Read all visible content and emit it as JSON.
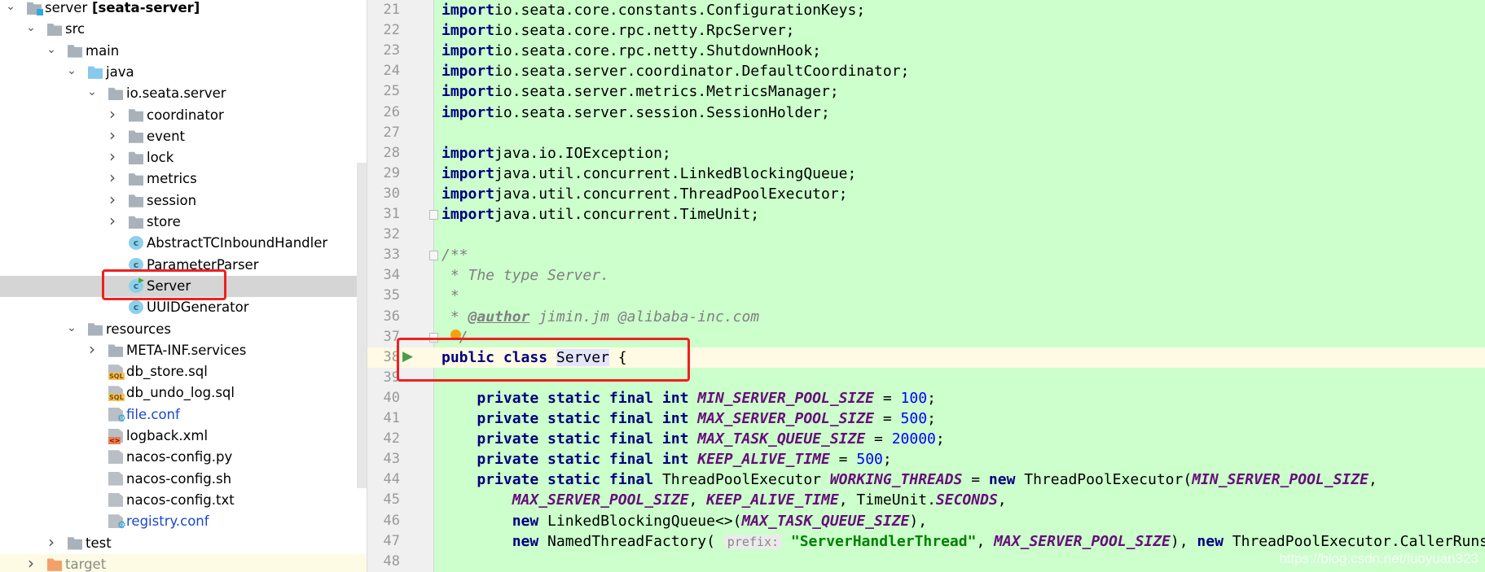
{
  "project_tree": [
    {
      "label": "server",
      "suffix": " [seata-server]",
      "level": 0,
      "chevron": "down",
      "icon": "module-folder-icon"
    },
    {
      "label": "src",
      "level": 1,
      "chevron": "down",
      "icon": "folder-icon"
    },
    {
      "label": "main",
      "level": 2,
      "chevron": "down",
      "icon": "folder-icon"
    },
    {
      "label": "java",
      "level": 3,
      "chevron": "down",
      "icon": "source-folder-icon"
    },
    {
      "label": "io.seata.server",
      "level": 4,
      "chevron": "down",
      "icon": "package-icon"
    },
    {
      "label": "coordinator",
      "level": 5,
      "chevron": "right",
      "icon": "package-icon"
    },
    {
      "label": "event",
      "level": 5,
      "chevron": "right",
      "icon": "package-icon"
    },
    {
      "label": "lock",
      "level": 5,
      "chevron": "right",
      "icon": "package-icon"
    },
    {
      "label": "metrics",
      "level": 5,
      "chevron": "right",
      "icon": "package-icon"
    },
    {
      "label": "session",
      "level": 5,
      "chevron": "right",
      "icon": "package-icon"
    },
    {
      "label": "store",
      "level": 5,
      "chevron": "right",
      "icon": "package-icon"
    },
    {
      "label": "AbstractTCInboundHandler",
      "level": 5,
      "chevron": "",
      "icon": "abstract-class-icon"
    },
    {
      "label": "ParameterParser",
      "level": 5,
      "chevron": "",
      "icon": "class-icon"
    },
    {
      "label": "Server",
      "level": 5,
      "chevron": "",
      "icon": "runnable-class-icon",
      "selected": true
    },
    {
      "label": "UUIDGenerator",
      "level": 5,
      "chevron": "",
      "icon": "class-icon"
    },
    {
      "label": "resources",
      "level": 3,
      "chevron": "down",
      "icon": "resources-folder-icon"
    },
    {
      "label": "META-INF.services",
      "level": 4,
      "chevron": "right",
      "icon": "package-icon"
    },
    {
      "label": "db_store.sql",
      "level": 4,
      "chevron": "",
      "icon": "sql-file-icon"
    },
    {
      "label": "db_undo_log.sql",
      "level": 4,
      "chevron": "",
      "icon": "sql-file-icon"
    },
    {
      "label": "file.conf",
      "level": 4,
      "chevron": "",
      "icon": "config-file-icon",
      "color": "#1a47c8"
    },
    {
      "label": "logback.xml",
      "level": 4,
      "chevron": "",
      "icon": "xml-file-icon"
    },
    {
      "label": "nacos-config.py",
      "level": 4,
      "chevron": "",
      "icon": "text-file-icon"
    },
    {
      "label": "nacos-config.sh",
      "level": 4,
      "chevron": "",
      "icon": "text-file-icon"
    },
    {
      "label": "nacos-config.txt",
      "level": 4,
      "chevron": "",
      "icon": "text-file-icon"
    },
    {
      "label": "registry.conf",
      "level": 4,
      "chevron": "",
      "icon": "config-file-icon",
      "color": "#1a47c8"
    },
    {
      "label": "test",
      "level": 2,
      "chevron": "right",
      "icon": "folder-icon"
    },
    {
      "label": "target",
      "level": 1,
      "chevron": "right",
      "icon": "excluded-folder-icon",
      "color": "#8a8a8a",
      "excluded": true
    }
  ],
  "editor": {
    "caret_line": 38,
    "lines": [
      {
        "n": 21,
        "t": [
          [
            "kw",
            "import"
          ],
          [
            "",
            "io.seata.core.constants.ConfigurationKeys;"
          ]
        ]
      },
      {
        "n": 22,
        "t": [
          [
            "kw",
            "import"
          ],
          [
            "",
            "io.seata.core.rpc.netty.RpcServer;"
          ]
        ]
      },
      {
        "n": 23,
        "t": [
          [
            "kw",
            "import"
          ],
          [
            "",
            "io.seata.core.rpc.netty.ShutdownHook;"
          ]
        ]
      },
      {
        "n": 24,
        "t": [
          [
            "kw",
            "import"
          ],
          [
            "",
            "io.seata.server.coordinator.DefaultCoordinator;"
          ]
        ]
      },
      {
        "n": 25,
        "t": [
          [
            "kw",
            "import"
          ],
          [
            "",
            "io.seata.server.metrics.MetricsManager;"
          ]
        ]
      },
      {
        "n": 26,
        "t": [
          [
            "kw",
            "import"
          ],
          [
            "",
            "io.seata.server.session.SessionHolder;"
          ]
        ]
      },
      {
        "n": 27,
        "t": []
      },
      {
        "n": 28,
        "t": [
          [
            "kw",
            "import"
          ],
          [
            "",
            "java.io.IOException;"
          ]
        ]
      },
      {
        "n": 29,
        "t": [
          [
            "kw",
            "import"
          ],
          [
            "",
            "java.util.concurrent.LinkedBlockingQueue;"
          ]
        ]
      },
      {
        "n": 30,
        "t": [
          [
            "kw",
            "import"
          ],
          [
            "",
            "java.util.concurrent.ThreadPoolExecutor;"
          ]
        ]
      },
      {
        "n": 31,
        "t": [
          [
            "kw",
            "import"
          ],
          [
            "",
            "java.util.concurrent.TimeUnit;"
          ]
        ],
        "fold": true
      },
      {
        "n": 32,
        "t": []
      },
      {
        "n": 33,
        "t": [
          [
            "cm",
            "/**"
          ]
        ],
        "fold": true
      },
      {
        "n": 34,
        "t": [
          [
            "cm",
            " * The type Server."
          ]
        ]
      },
      {
        "n": 35,
        "t": [
          [
            "cm",
            " *"
          ]
        ]
      },
      {
        "n": 36,
        "t": [
          [
            "cm",
            " * "
          ],
          [
            "tag",
            "@author"
          ],
          [
            "cm",
            " jimin.jm @alibaba-inc.com"
          ]
        ]
      },
      {
        "n": 37,
        "t": [
          [
            "cm",
            "  /"
          ]
        ],
        "fold": true,
        "bulb": true
      },
      {
        "n": 38,
        "t": [
          [
            "kw",
            "public class "
          ],
          [
            "hl",
            "Server"
          ],
          [
            "",
            " {"
          ]
        ],
        "run": true
      },
      {
        "n": 39,
        "t": []
      },
      {
        "n": 40,
        "t": [
          [
            "kw",
            "    private static final int "
          ],
          [
            "const",
            "MIN_SERVER_POOL_SIZE"
          ],
          [
            "",
            " = "
          ],
          [
            "num",
            "100"
          ],
          [
            "",
            ";"
          ]
        ]
      },
      {
        "n": 41,
        "t": [
          [
            "kw",
            "    private static final int "
          ],
          [
            "const",
            "MAX_SERVER_POOL_SIZE"
          ],
          [
            "",
            " = "
          ],
          [
            "num",
            "500"
          ],
          [
            "",
            ";"
          ]
        ]
      },
      {
        "n": 42,
        "t": [
          [
            "kw",
            "    private static final int "
          ],
          [
            "const",
            "MAX_TASK_QUEUE_SIZE"
          ],
          [
            "",
            " = "
          ],
          [
            "num",
            "20000"
          ],
          [
            "",
            ";"
          ]
        ]
      },
      {
        "n": 43,
        "t": [
          [
            "kw",
            "    private static final int "
          ],
          [
            "const",
            "KEEP_ALIVE_TIME"
          ],
          [
            "",
            " = "
          ],
          [
            "num",
            "500"
          ],
          [
            "",
            ";"
          ]
        ]
      },
      {
        "n": 44,
        "t": [
          [
            "kw",
            "    private static final "
          ],
          [
            "",
            "ThreadPoolExecutor "
          ],
          [
            "const",
            "WORKING_THREADS"
          ],
          [
            "",
            " = "
          ],
          [
            "kw",
            "new "
          ],
          [
            "",
            "ThreadPoolExecutor("
          ],
          [
            "const",
            "MIN_SERVER_POOL_SIZE"
          ],
          [
            "",
            ","
          ]
        ]
      },
      {
        "n": 45,
        "t": [
          [
            "",
            "        "
          ],
          [
            "const",
            "MAX_SERVER_POOL_SIZE"
          ],
          [
            "",
            ", "
          ],
          [
            "const",
            "KEEP_ALIVE_TIME"
          ],
          [
            "",
            ", TimeUnit."
          ],
          [
            "const",
            "SECONDS"
          ],
          [
            "",
            ","
          ]
        ]
      },
      {
        "n": 46,
        "t": [
          [
            "kw",
            "        new "
          ],
          [
            "",
            "LinkedBlockingQueue<>("
          ],
          [
            "const",
            "MAX_TASK_QUEUE_SIZE"
          ],
          [
            "",
            "),"
          ]
        ]
      },
      {
        "n": 47,
        "t": [
          [
            "kw",
            "        new "
          ],
          [
            "",
            "NamedThreadFactory( "
          ],
          [
            "hint",
            "prefix:"
          ],
          [
            "",
            " "
          ],
          [
            "str",
            "\"ServerHandlerThread\""
          ],
          [
            "",
            ", "
          ],
          [
            "const",
            "MAX_SERVER_POOL_SIZE"
          ],
          [
            "",
            "), "
          ],
          [
            "kw",
            "new "
          ],
          [
            "",
            "ThreadPoolExecutor.CallerRuns"
          ]
        ]
      },
      {
        "n": 48,
        "t": []
      }
    ]
  },
  "watermark": "https://blog.csdn.net/luoyuan323",
  "colors": {
    "editor_bg": "#ccffcc",
    "keyword": "#000080",
    "constant": "#660e7a",
    "number": "#0000ff",
    "string": "#008000",
    "highlight_box": "#f02020"
  }
}
